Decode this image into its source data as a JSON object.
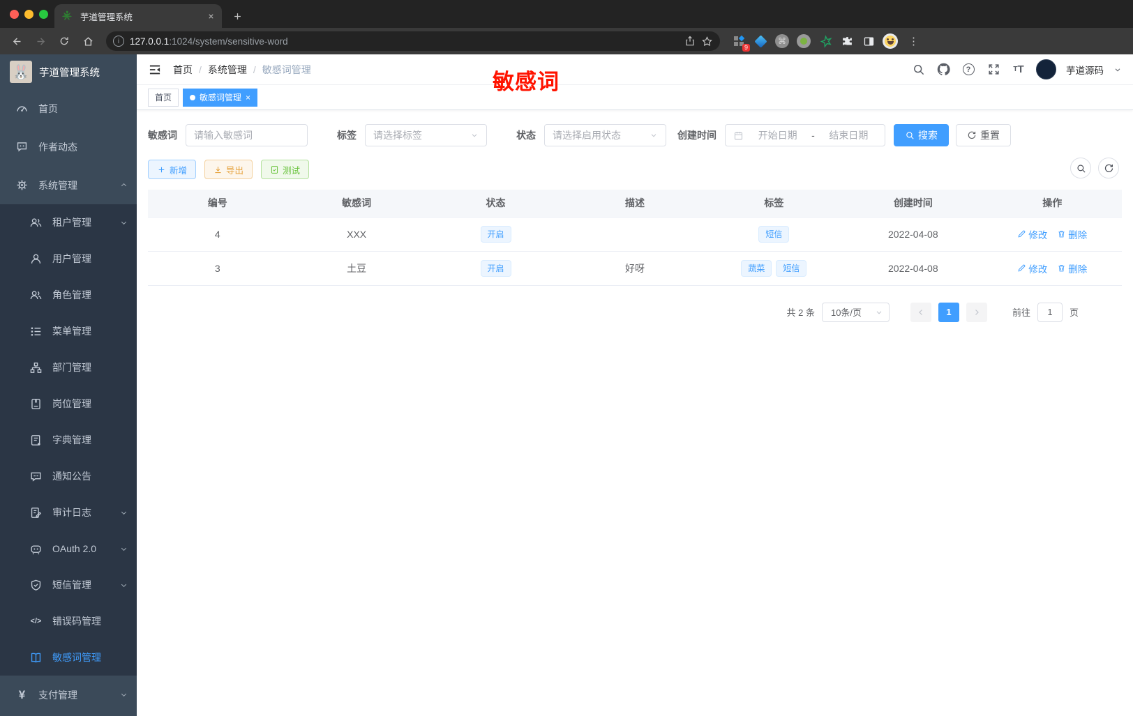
{
  "browser": {
    "tab_title": "芋道管理系统",
    "url_host": "127.0.0.1",
    "url_rest": ":1024/system/sensitive-word",
    "extension_badge": "9",
    "kebab": "⋮",
    "cmd_glyph": "⌘"
  },
  "annotation": "敏感词",
  "sidebar": {
    "logo_title": "芋道管理系统",
    "top": [
      {
        "label": "首页",
        "icon": "dashboard-icon"
      },
      {
        "label": "作者动态",
        "icon": "chat-icon"
      },
      {
        "label": "系统管理",
        "icon": "gear-icon"
      }
    ],
    "sub": [
      {
        "label": "租户管理",
        "icon": "users-icon"
      },
      {
        "label": "用户管理",
        "icon": "user-icon"
      },
      {
        "label": "角色管理",
        "icon": "roles-icon"
      },
      {
        "label": "菜单管理",
        "icon": "menu-tree-icon"
      },
      {
        "label": "部门管理",
        "icon": "org-icon"
      },
      {
        "label": "岗位管理",
        "icon": "badge-icon"
      },
      {
        "label": "字典管理",
        "icon": "dictionary-icon"
      },
      {
        "label": "通知公告",
        "icon": "notice-icon"
      },
      {
        "label": "审计日志",
        "icon": "audit-icon"
      },
      {
        "label": "OAuth 2.0",
        "icon": "oauth-icon"
      },
      {
        "label": "短信管理",
        "icon": "sms-shield-icon"
      },
      {
        "label": "错误码管理",
        "icon": "code-icon",
        "glyph": "</>"
      },
      {
        "label": "敏感词管理",
        "icon": "open-book-icon"
      }
    ],
    "bottom": [
      {
        "label": "支付管理",
        "icon": "yen-icon",
        "glyph": "¥"
      }
    ]
  },
  "header": {
    "breadcrumb": [
      "首页",
      "系统管理",
      "敏感词管理"
    ],
    "username": "芋道源码"
  },
  "tags": {
    "home": "首页",
    "active": "敏感词管理"
  },
  "filter": {
    "keyword_label": "敏感词",
    "keyword_placeholder": "请输入敏感词",
    "tag_label": "标签",
    "tag_placeholder": "请选择标签",
    "status_label": "状态",
    "status_placeholder": "请选择启用状态",
    "date_label": "创建时间",
    "date_start": "开始日期",
    "date_separator": "-",
    "date_end": "结束日期",
    "search_label": "搜索",
    "reset_label": "重置"
  },
  "toolbar": {
    "add_label": "新增",
    "export_label": "导出",
    "test_label": "测试"
  },
  "table": {
    "headers": [
      "编号",
      "敏感词",
      "状态",
      "描述",
      "标签",
      "创建时间",
      "操作"
    ],
    "rows": [
      {
        "id": "4",
        "word": "XXX",
        "status": "开启",
        "desc": "",
        "tags": [
          "短信"
        ],
        "created": "2022-04-08",
        "edit": "修改",
        "delete": "删除"
      },
      {
        "id": "3",
        "word": "土豆",
        "status": "开启",
        "desc": "好呀",
        "tags": [
          "蔬菜",
          "短信"
        ],
        "created": "2022-04-08",
        "edit": "修改",
        "delete": "删除"
      }
    ]
  },
  "pagination": {
    "total": "共 2 条",
    "page_size": "10条/页",
    "current_page": "1",
    "goto_label": "前往",
    "goto_value": "1",
    "page_unit": "页"
  },
  "colors": {
    "accent": "#409eff",
    "warning": "#e6a23c",
    "success": "#67c23a",
    "annotation_red": "#ff1300",
    "sidebar_bg": "#3b4a59",
    "submenu_bg": "#2b3645"
  }
}
